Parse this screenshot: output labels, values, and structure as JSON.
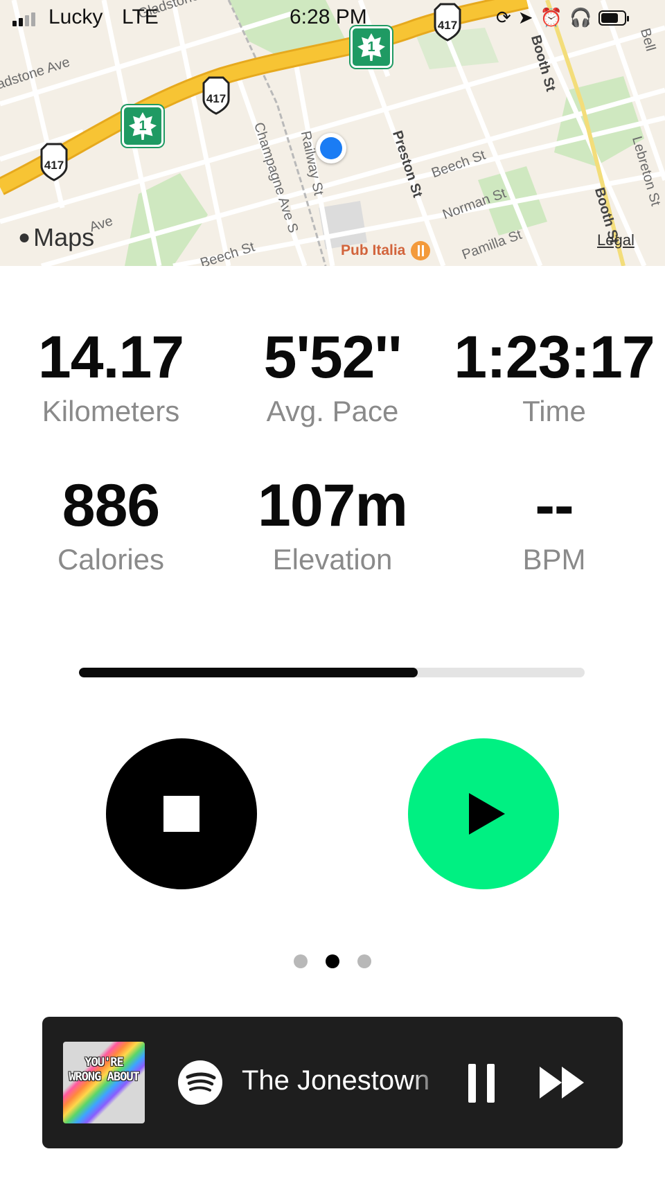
{
  "status_bar": {
    "carrier": "Lucky",
    "network": "LTE",
    "time": "6:28 PM"
  },
  "map": {
    "logo_text": "Maps",
    "legal_label": "Legal",
    "poi_name": "Pub Italia",
    "streets": {
      "gladstone_ave": "adstone Ave",
      "gladstone_top": "Gladstone",
      "champagne": "Champagne Ave S",
      "railway": "Railway St",
      "preston": "Preston St",
      "beech_1": "Beech St",
      "beech_2": "Beech St",
      "norman": "Norman St",
      "pamilla": "Pamilla St",
      "booth_1": "Booth St",
      "booth_2": "Booth St",
      "lebreton": "Lebreton St",
      "bell": "Bell",
      "ave_bottom": "Ave"
    },
    "route_shields": [
      "417",
      "417",
      "417"
    ],
    "maple_shields": [
      "1",
      "1"
    ],
    "colors": {
      "highway": "#f7c434",
      "park": "#cfe8c0",
      "road": "#ffffff",
      "background": "#f4efe6"
    }
  },
  "stats": [
    {
      "value": "14.17",
      "label": "Kilometers"
    },
    {
      "value": "5'52''",
      "label": "Avg. Pace"
    },
    {
      "value": "1:23:17",
      "label": "Time"
    },
    {
      "value": "886",
      "label": "Calories"
    },
    {
      "value": "107m",
      "label": "Elevation"
    },
    {
      "value": "--",
      "label": "BPM"
    }
  ],
  "progress": {
    "fraction": 0.67
  },
  "controls": {
    "stop_icon": "stop-icon",
    "play_icon": "play-icon",
    "play_color": "#00f082"
  },
  "page_indicator": {
    "count": 3,
    "active_index": 1
  },
  "music": {
    "album_art_text": "YOU'RE WRONG ABOUT",
    "source_icon": "spotify-icon",
    "track_title": "The Jonestown",
    "pause_icon": "pause-icon",
    "skip_icon": "fast-forward-icon"
  }
}
